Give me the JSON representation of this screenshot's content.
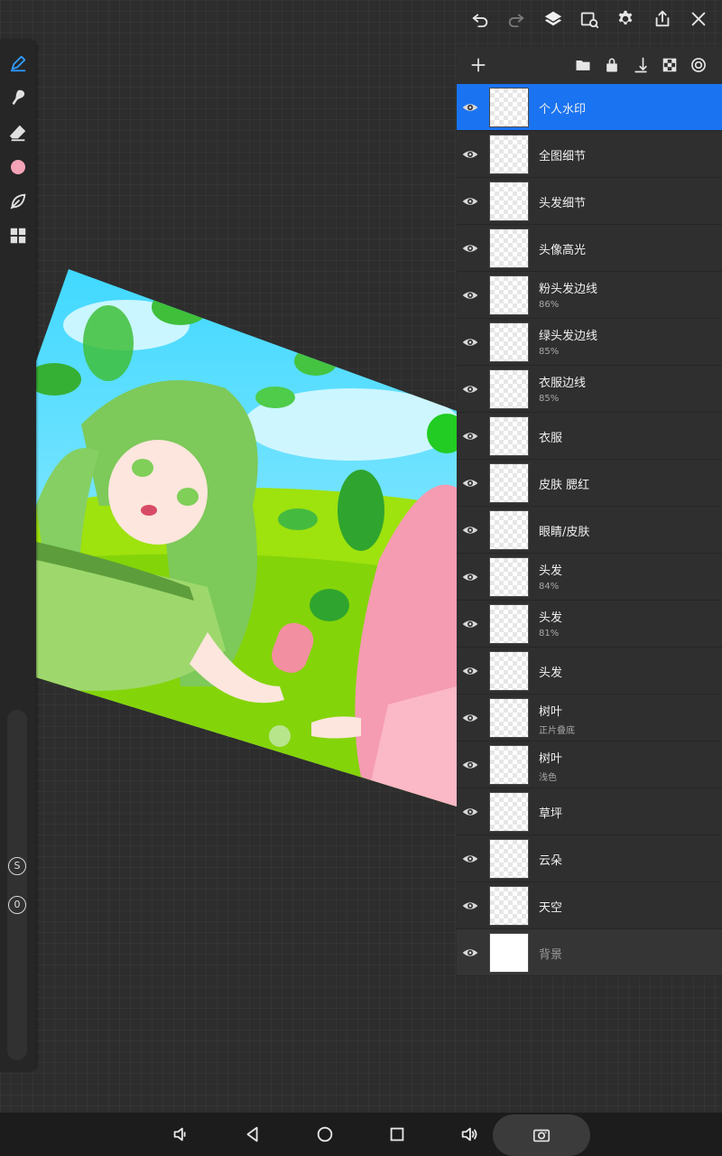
{
  "icons": {
    "undo": "undo-icon",
    "redo": "redo-icon",
    "layers": "layers-icon",
    "reference": "reference-icon",
    "settings": "gear-icon",
    "share": "share-icon",
    "close": "close-icon"
  },
  "left_tools": {
    "active_tool": "pen",
    "current_color": "#f5a3b7",
    "size_badge": "S",
    "opacity_badge": "0"
  },
  "layers": [
    {
      "name": "个人水印",
      "sub": "",
      "selected": true
    },
    {
      "name": "全图细节",
      "sub": ""
    },
    {
      "name": "头发细节",
      "sub": ""
    },
    {
      "name": "头像高光",
      "sub": ""
    },
    {
      "name": "粉头发边线",
      "sub": "86%"
    },
    {
      "name": "绿头发边线",
      "sub": "85%"
    },
    {
      "name": "衣服边线",
      "sub": "85%"
    },
    {
      "name": "衣服",
      "sub": ""
    },
    {
      "name": "皮肤 腮红",
      "sub": ""
    },
    {
      "name": "眼睛/皮肤",
      "sub": ""
    },
    {
      "name": "头发",
      "sub": "84%"
    },
    {
      "name": "头发",
      "sub": "81%"
    },
    {
      "name": "头发",
      "sub": ""
    },
    {
      "name": "树叶",
      "sub": "正片叠底"
    },
    {
      "name": "树叶",
      "sub": "浅色"
    },
    {
      "name": "草坪",
      "sub": ""
    },
    {
      "name": "云朵",
      "sub": ""
    },
    {
      "name": "天空",
      "sub": ""
    },
    {
      "name": "背景",
      "sub": ""
    }
  ],
  "colors": {
    "selection": "#1a73f0",
    "panel": "#2f2f2f",
    "canvas": "#2d2d2d"
  }
}
